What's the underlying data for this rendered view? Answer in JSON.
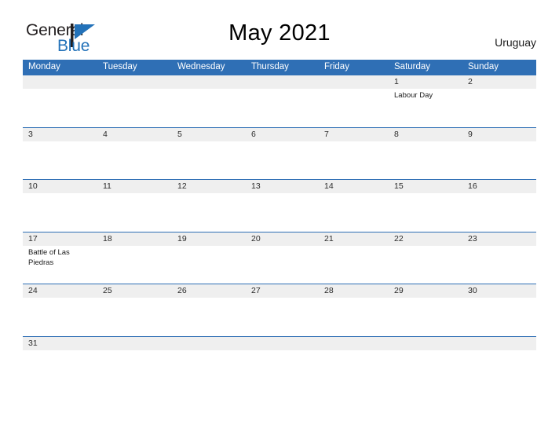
{
  "brand": {
    "name_primary": "General",
    "name_secondary": "Blue",
    "logo_icon": "blue-flag-triangle-icon",
    "color_primary": "#231f20",
    "color_secondary": "#2372b9"
  },
  "header": {
    "title": "May 2021",
    "country": "Uruguay"
  },
  "calendar": {
    "accent_color": "#2f6fb5",
    "date_band_color": "#efefef",
    "weekdays": [
      "Monday",
      "Tuesday",
      "Wednesday",
      "Thursday",
      "Friday",
      "Saturday",
      "Sunday"
    ],
    "weeks": [
      {
        "days": [
          {
            "date": "",
            "event": ""
          },
          {
            "date": "",
            "event": ""
          },
          {
            "date": "",
            "event": ""
          },
          {
            "date": "",
            "event": ""
          },
          {
            "date": "",
            "event": ""
          },
          {
            "date": "1",
            "event": "Labour Day"
          },
          {
            "date": "2",
            "event": ""
          }
        ]
      },
      {
        "days": [
          {
            "date": "3",
            "event": ""
          },
          {
            "date": "4",
            "event": ""
          },
          {
            "date": "5",
            "event": ""
          },
          {
            "date": "6",
            "event": ""
          },
          {
            "date": "7",
            "event": ""
          },
          {
            "date": "8",
            "event": ""
          },
          {
            "date": "9",
            "event": ""
          }
        ]
      },
      {
        "days": [
          {
            "date": "10",
            "event": ""
          },
          {
            "date": "11",
            "event": ""
          },
          {
            "date": "12",
            "event": ""
          },
          {
            "date": "13",
            "event": ""
          },
          {
            "date": "14",
            "event": ""
          },
          {
            "date": "15",
            "event": ""
          },
          {
            "date": "16",
            "event": ""
          }
        ]
      },
      {
        "days": [
          {
            "date": "17",
            "event": "Battle of Las Piedras"
          },
          {
            "date": "18",
            "event": ""
          },
          {
            "date": "19",
            "event": ""
          },
          {
            "date": "20",
            "event": ""
          },
          {
            "date": "21",
            "event": ""
          },
          {
            "date": "22",
            "event": ""
          },
          {
            "date": "23",
            "event": ""
          }
        ]
      },
      {
        "days": [
          {
            "date": "24",
            "event": ""
          },
          {
            "date": "25",
            "event": ""
          },
          {
            "date": "26",
            "event": ""
          },
          {
            "date": "27",
            "event": ""
          },
          {
            "date": "28",
            "event": ""
          },
          {
            "date": "29",
            "event": ""
          },
          {
            "date": "30",
            "event": ""
          }
        ]
      },
      {
        "days": [
          {
            "date": "31",
            "event": ""
          },
          {
            "date": "",
            "event": ""
          },
          {
            "date": "",
            "event": ""
          },
          {
            "date": "",
            "event": ""
          },
          {
            "date": "",
            "event": ""
          },
          {
            "date": "",
            "event": ""
          },
          {
            "date": "",
            "event": ""
          }
        ]
      }
    ]
  }
}
